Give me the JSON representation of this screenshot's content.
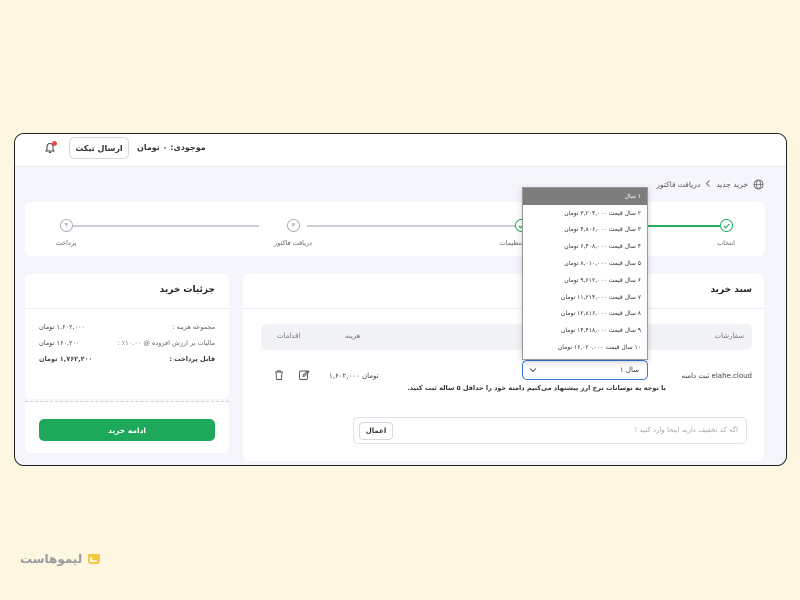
{
  "topbar": {
    "ticket_button": "ارسال تیکت",
    "balance": "موجودی: ۰ تومان",
    "icons": {
      "notification": "bell-icon"
    }
  },
  "breadcrumb": {
    "home_icon": "globe-icon",
    "items": [
      "خرید جدید",
      "دریافت فاکتور"
    ]
  },
  "steps": [
    {
      "label": "انتخاب",
      "status": "done"
    },
    {
      "label": "تنظیمات",
      "status": "done"
    },
    {
      "label": "دریافت فاکتور",
      "number": "۳",
      "status": "pending"
    },
    {
      "label": "پرداخت",
      "number": "۴",
      "status": "pending"
    }
  ],
  "details": {
    "title": "جزئیات خرید",
    "rows": [
      {
        "label": "مجموعه هزینه :",
        "value": "۱,۶۰۲,۰۰۰ تومان"
      },
      {
        "label": "مالیات بر ارزش افزوده @ ۱۰.۰۰٪ :",
        "value": "۱۶۰,۲۰۰ تومان"
      },
      {
        "label": "قابل پرداخت :",
        "value": "۱,۷۶۲,۲۰۰ تومان"
      }
    ],
    "continue_button": "ادامه خرید"
  },
  "cart": {
    "title": "سبد خرید",
    "columns": {
      "orders": "سفارشات",
      "cost": "هزینه",
      "actions": "اقدامات"
    },
    "row": {
      "name": "ثبت دامنه elahe.cloud",
      "price": "۱,۶۰۲,۰۰۰ تومان",
      "period": "۱ سال"
    },
    "note": "با توجه به نوسانات نرخ ارز پیشنهاد می‌کنیم دامنه خود را حداقل ۵ ساله ثبت کنید.",
    "coupon": {
      "placeholder": "اگه کد تخفیف دارید اینجا وارد کنید !",
      "apply_button": "اعمال"
    }
  },
  "dropdown": {
    "options": [
      "۱ سال",
      "۲ سال قیمت ۳,۲۰۴,۰۰۰ تومان",
      "۳ سال قیمت ۴,۸۰۶,۰۰۰ تومان",
      "۴ سال قیمت ۶,۴۰۸,۰۰۰ تومان",
      "۵ سال قیمت ۸,۰۱۰,۰۰۰ تومان",
      "۶ سال قیمت ۹,۶۱۲,۰۰۰ تومان",
      "۷ سال قیمت ۱۱,۲۱۴,۰۰۰ تومان",
      "۸ سال قیمت ۱۲,۸۱۶,۰۰۰ تومان",
      "۹ سال قیمت ۱۴,۴۱۸,۰۰۰ تومان",
      "۱۰ سال قیمت ۱۶,۰۲۰,۰۰۰ تومان"
    ],
    "selected_index": 0
  },
  "brand": {
    "name": "لیموهاست"
  },
  "colors": {
    "primary_green": "#1da85a",
    "select_blue": "#3a77d8",
    "page_background": "#fdf7e2"
  }
}
